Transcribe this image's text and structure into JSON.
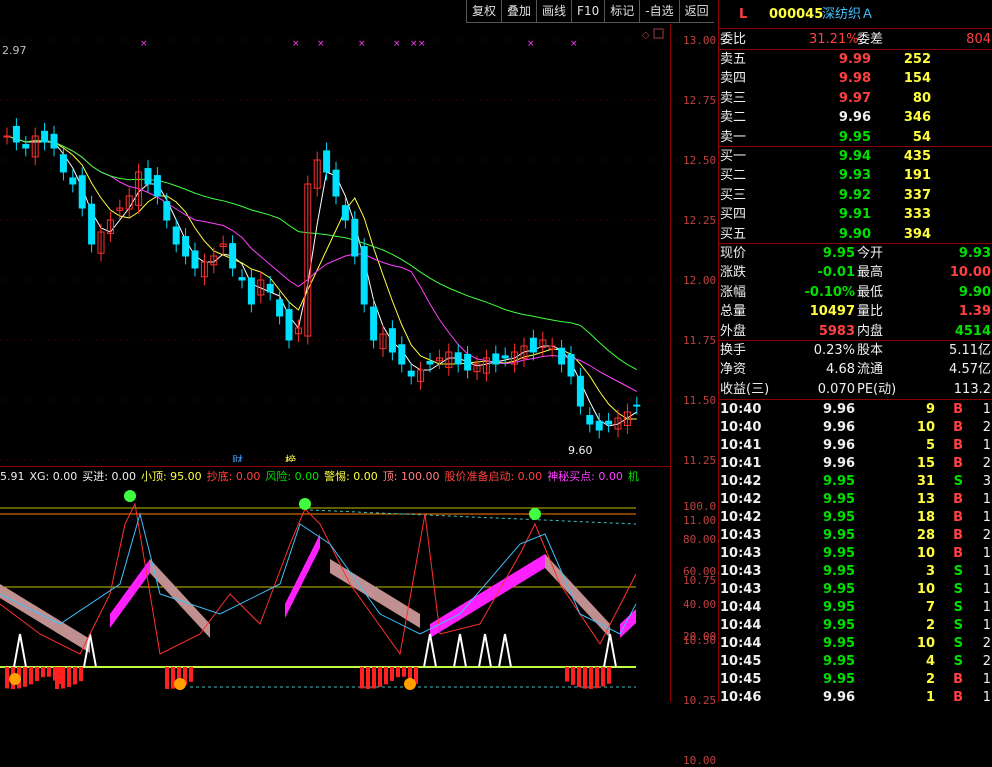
{
  "toolbar": [
    "复权",
    "叠加",
    "画线",
    "F10",
    "标记",
    "-自选",
    "返回"
  ],
  "stock": {
    "flag": "L",
    "code": "000045",
    "name": "深纺织Ａ"
  },
  "ratio": {
    "wb_label": "委比",
    "wb_value": "31.21%",
    "wc_label": "委差",
    "wc_value": "804"
  },
  "asks": [
    {
      "label": "卖五",
      "price": "9.99",
      "vol": "252",
      "color": "#ff4040"
    },
    {
      "label": "卖四",
      "price": "9.98",
      "vol": "154",
      "color": "#ff4040"
    },
    {
      "label": "卖三",
      "price": "9.97",
      "vol": "80",
      "color": "#ff4040"
    },
    {
      "label": "卖二",
      "price": "9.96",
      "vol": "346",
      "color": "#f0f0f0"
    },
    {
      "label": "卖一",
      "price": "9.95",
      "vol": "54",
      "color": "#00e000"
    }
  ],
  "bids": [
    {
      "label": "买一",
      "price": "9.94",
      "vol": "435"
    },
    {
      "label": "买二",
      "price": "9.93",
      "vol": "191"
    },
    {
      "label": "买三",
      "price": "9.92",
      "vol": "337"
    },
    {
      "label": "买四",
      "price": "9.91",
      "vol": "333"
    },
    {
      "label": "买五",
      "price": "9.90",
      "vol": "394"
    }
  ],
  "quote": [
    {
      "l1": "现价",
      "v1": "9.95",
      "c1": "#00e000",
      "l2": "今开",
      "v2": "9.93",
      "c2": "#00e000"
    },
    {
      "l1": "涨跌",
      "v1": "-0.01",
      "c1": "#00e000",
      "l2": "最高",
      "v2": "10.00",
      "c2": "#ff4040"
    },
    {
      "l1": "涨幅",
      "v1": "-0.10%",
      "c1": "#00e000",
      "l2": "最低",
      "v2": "9.90",
      "c2": "#00e000"
    },
    {
      "l1": "总量",
      "v1": "10497",
      "c1": "#ffff40",
      "l2": "量比",
      "v2": "1.39",
      "c2": "#ff4040"
    },
    {
      "l1": "外盘",
      "v1": "5983",
      "c1": "#ff4040",
      "l2": "内盘",
      "v2": "4514",
      "c2": "#00e000"
    }
  ],
  "fund": [
    {
      "l1": "换手",
      "v1": "0.23%",
      "l2": "股本",
      "v2": "5.11亿"
    },
    {
      "l1": "净资",
      "v1": "4.68",
      "l2": "流通",
      "v2": "4.57亿"
    },
    {
      "l1": "收益(三)",
      "v1": "0.070",
      "l2": "PE(动)",
      "v2": "113.2"
    }
  ],
  "ticks": [
    {
      "t": "10:40",
      "p": "9.96",
      "pc": "#f0f0f0",
      "v": "9",
      "d": "B",
      "n": "1"
    },
    {
      "t": "10:40",
      "p": "9.96",
      "pc": "#f0f0f0",
      "v": "10",
      "d": "B",
      "n": "2"
    },
    {
      "t": "10:41",
      "p": "9.96",
      "pc": "#f0f0f0",
      "v": "5",
      "d": "B",
      "n": "1"
    },
    {
      "t": "10:41",
      "p": "9.96",
      "pc": "#f0f0f0",
      "v": "15",
      "d": "B",
      "n": "2"
    },
    {
      "t": "10:42",
      "p": "9.95",
      "pc": "#00e000",
      "v": "31",
      "d": "S",
      "n": "3"
    },
    {
      "t": "10:42",
      "p": "9.95",
      "pc": "#00e000",
      "v": "13",
      "d": "B",
      "n": "1"
    },
    {
      "t": "10:42",
      "p": "9.95",
      "pc": "#00e000",
      "v": "18",
      "d": "B",
      "n": "1"
    },
    {
      "t": "10:43",
      "p": "9.95",
      "pc": "#00e000",
      "v": "28",
      "d": "B",
      "n": "2"
    },
    {
      "t": "10:43",
      "p": "9.95",
      "pc": "#00e000",
      "v": "10",
      "d": "B",
      "n": "1"
    },
    {
      "t": "10:43",
      "p": "9.95",
      "pc": "#00e000",
      "v": "3",
      "d": "S",
      "n": "1"
    },
    {
      "t": "10:43",
      "p": "9.95",
      "pc": "#00e000",
      "v": "10",
      "d": "S",
      "n": "1"
    },
    {
      "t": "10:44",
      "p": "9.95",
      "pc": "#00e000",
      "v": "7",
      "d": "S",
      "n": "1"
    },
    {
      "t": "10:44",
      "p": "9.95",
      "pc": "#00e000",
      "v": "2",
      "d": "S",
      "n": "1"
    },
    {
      "t": "10:44",
      "p": "9.95",
      "pc": "#00e000",
      "v": "10",
      "d": "S",
      "n": "2"
    },
    {
      "t": "10:45",
      "p": "9.95",
      "pc": "#00e000",
      "v": "4",
      "d": "S",
      "n": "2"
    },
    {
      "t": "10:45",
      "p": "9.95",
      "pc": "#00e000",
      "v": "2",
      "d": "B",
      "n": "1"
    },
    {
      "t": "10:46",
      "p": "9.96",
      "pc": "#f0f0f0",
      "v": "1",
      "d": "B",
      "n": "1"
    }
  ],
  "price_axis": [
    "13.00",
    "12.75",
    "12.50",
    "12.25",
    "12.00",
    "11.75",
    "11.50",
    "11.25",
    "11.00",
    "10.75",
    "10.50",
    "10.25",
    "10.00"
  ],
  "ind_axis": [
    "100.0",
    "80.00",
    "60.00",
    "40.00",
    "20.00"
  ],
  "chart_labels": {
    "top_left": "2.97",
    "low_mark": "9.60",
    "cai": "财",
    "bang": "榜"
  },
  "indicator": [
    {
      "text": "5.91",
      "color": "#f0f0f0"
    },
    {
      "text": "XG: 0.00",
      "color": "#f0f0f0"
    },
    {
      "text": "买进: 0.00",
      "color": "#f0f0f0"
    },
    {
      "text": "小顶: 95.00",
      "color": "#ffff40"
    },
    {
      "text": "抄底: 0.00",
      "color": "#ff4040"
    },
    {
      "text": "风险: 0.00",
      "color": "#00e000"
    },
    {
      "text": "警惕: 0.00",
      "color": "#ffff40"
    },
    {
      "text": "顶: 100.00",
      "color": "#ff8080"
    },
    {
      "text": "股价准备启动: 0.00",
      "color": "#ff4040"
    },
    {
      "text": "神秘买点: 0.00",
      "color": "#ff40ff"
    },
    {
      "text": "机",
      "color": "#00e000"
    }
  ]
}
